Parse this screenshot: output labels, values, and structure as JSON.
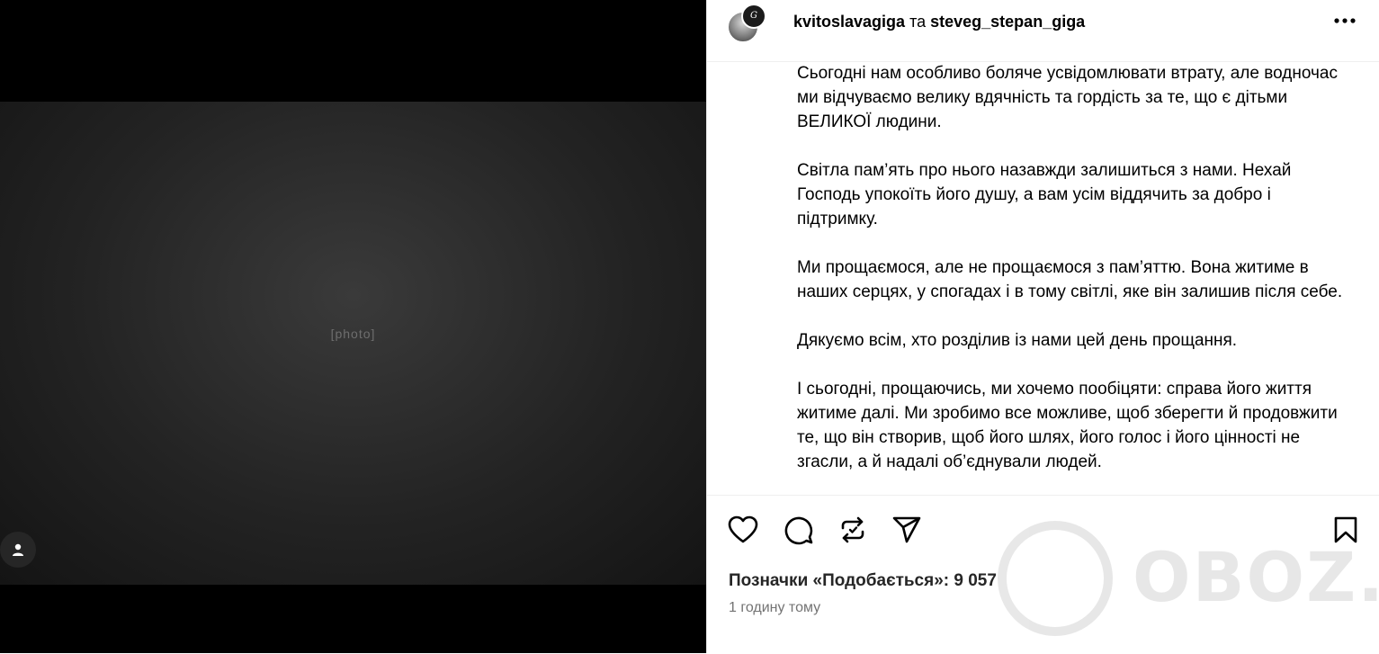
{
  "post": {
    "author_primary": "kvitoslavagiga",
    "author_joiner": "та",
    "author_secondary": "steveg_stepan_giga",
    "menu_icon": "more-horizontal-icon"
  },
  "media": {
    "tag_icon": "user-tag-icon"
  },
  "caption": {
    "paragraphs": [
      "Сьогодні нам особливо боляче усвідомлювати втрату, але водночас ми відчуваємо велику вдячність та гордість за те, що є дітьми ВЕЛИКОЇ людини.",
      "Світла пам’ять про нього назавжди залишиться з нами. Нехай Господь упокоїть його душу, а вам усім віддячить за добро і підтримку.",
      "Ми прощаємося, але не прощаємося з пам’яттю. Вона житиме в наших серцях, у спогадах і в тому світлі, яке він залишив після себе.",
      "Дякуємо всім, хто розділив із нами цей день прощання.",
      "І сьогодні, прощаючись, ми хочемо пообіцяти: справа його життя житиме далі. Ми зробимо все можливе, щоб зберегти й продовжити те, що він створив, щоб його шлях, його голос і його цінності не згасли, а й надалі об’єднували людей."
    ]
  },
  "actions": {
    "likes_text": "Позначки «Подобається»: 9 057",
    "time_text": "1 годину тому",
    "icons": [
      "heart-icon",
      "comment-icon",
      "repost-icon",
      "share-icon",
      "bookmark-icon"
    ]
  },
  "watermark": {
    "text": "OBOZ.UA"
  }
}
